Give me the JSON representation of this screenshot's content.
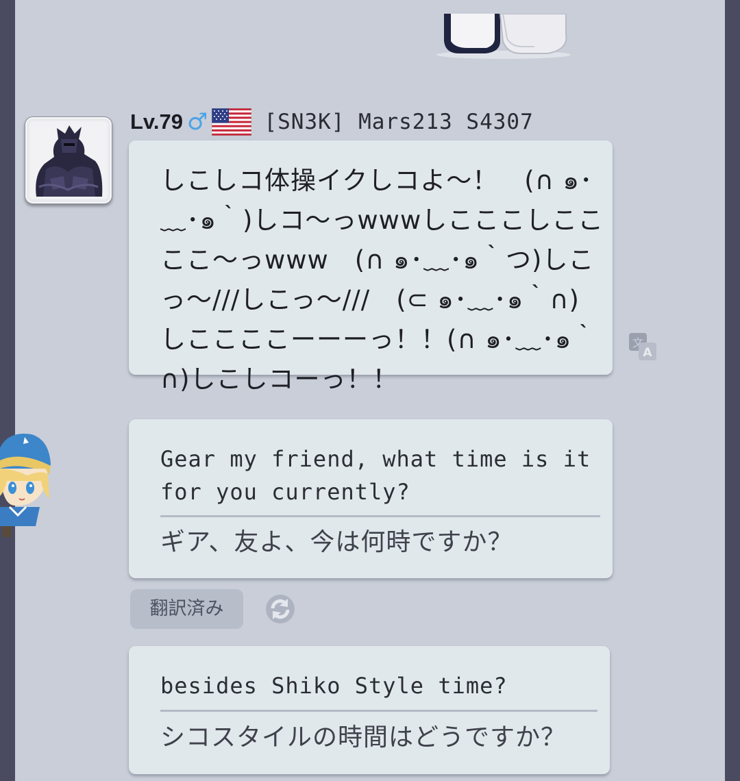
{
  "sender": {
    "level": "Lv.79",
    "gender_symbol": "♂",
    "flag_icon": "us-flag-icon",
    "tag_and_name": "[SN3K] Mars213 S4307"
  },
  "messages": [
    {
      "text": "しこしコ体操イクしコよ～！　(∩ ๑･﹏･๑｀)しコ～っwwwしこここしここここ～っwww　(∩ ๑･﹏･๑｀つ)しこっ～///しこっ～///　(⊂ ๑･﹏･๑｀∩)　しここここーーーっ！！(∩ ๑･﹏･๑｀∩)しこしコーっ！！"
    },
    {
      "original": "Gear my friend, what time is it for you currently?",
      "translation": "ギア、友よ、今は何時ですか？"
    },
    {
      "original": "besides Shiko Style time?",
      "translation": "シコスタイルの時間はどうですか？"
    }
  ],
  "translated_chip": "翻訳済み",
  "colors": {
    "background": "#c9ced9",
    "bubble": "#e1e8ec",
    "gender_blue": "#4da3e6",
    "frame": "#4a4b61"
  }
}
